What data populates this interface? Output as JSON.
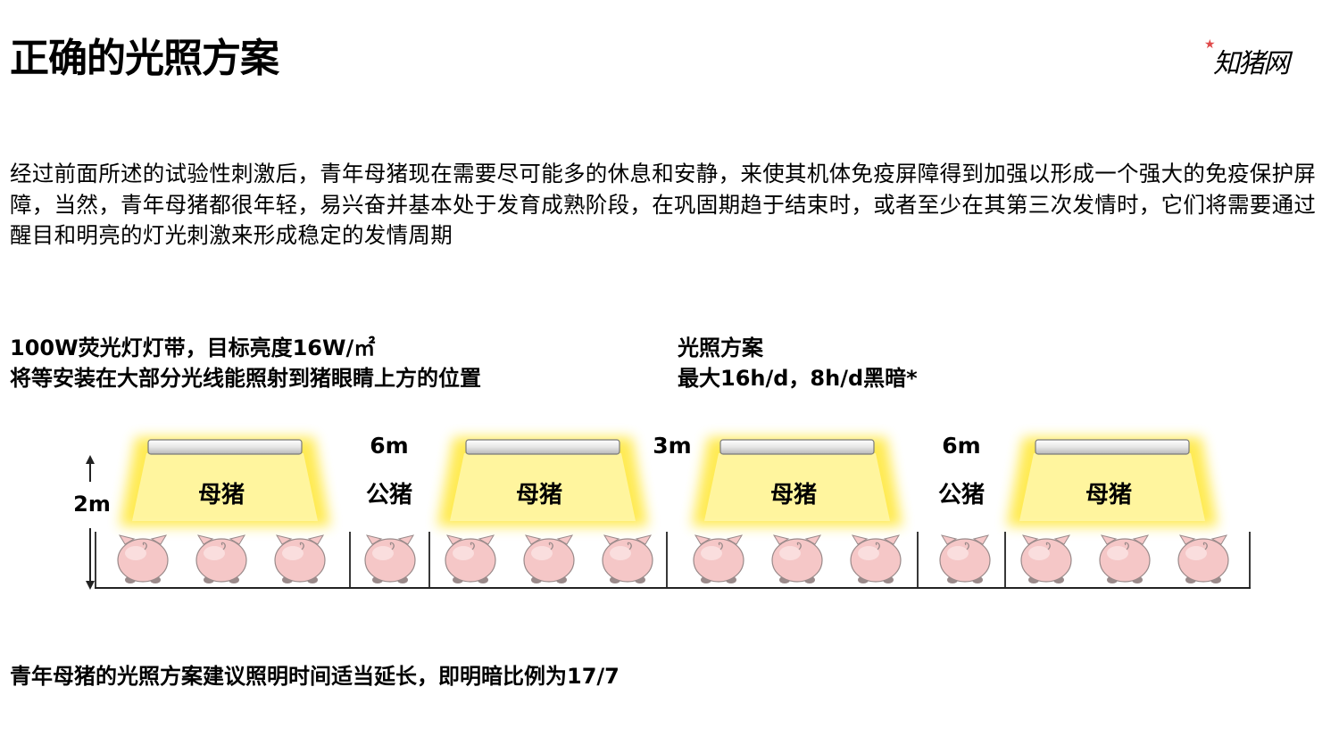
{
  "title": "正确的光照方案",
  "logo": {
    "text": "知猪网"
  },
  "intro": "经过前面所述的试验性刺激后，青年母猪现在需要尽可能多的休息和安静，来使其机体免疫屏障得到加强以形成一个强大的免疫保护屏障，当然，青年母猪都很年轻，易兴奋并基本处于发育成熟阶段，在巩固期趋于结束时，或者至少在其第三次发情时，它们将需要通过醒目和明亮的灯光刺激来形成稳定的发情周期",
  "lamp_info": {
    "line1": "100W荧光灯灯带，目标亮度16W/㎡",
    "line2": "将等安装在大部分光线能照射到猪眼睛上方的位置"
  },
  "scheme_info": {
    "line1": "光照方案",
    "line2": "最大16h/d，8h/d黑暗*"
  },
  "diagram": {
    "height_label": "2m",
    "colors": {
      "glow": "#ffe94a",
      "glow_fill": "#fff6a6",
      "lamp": "#f2f2f2",
      "pig": "#f5c7c7",
      "pig_outline": "#9a8a8a",
      "line": "#222222"
    },
    "lit_zones": [
      {
        "label": "母猪",
        "pigs": 3
      },
      {
        "label": "母猪",
        "pigs": 3
      },
      {
        "label": "母猪",
        "pigs": 3
      },
      {
        "label": "母猪",
        "pigs": 3
      }
    ],
    "boar_zones": [
      {
        "label": "公猪",
        "pigs": 1
      },
      {
        "label": "公猪",
        "pigs": 1
      }
    ],
    "spacings": [
      "6m",
      "3m",
      "6m"
    ]
  },
  "bottom_note": "青年母猪的光照方案建议照明时间适当延长，即明暗比例为17/7"
}
